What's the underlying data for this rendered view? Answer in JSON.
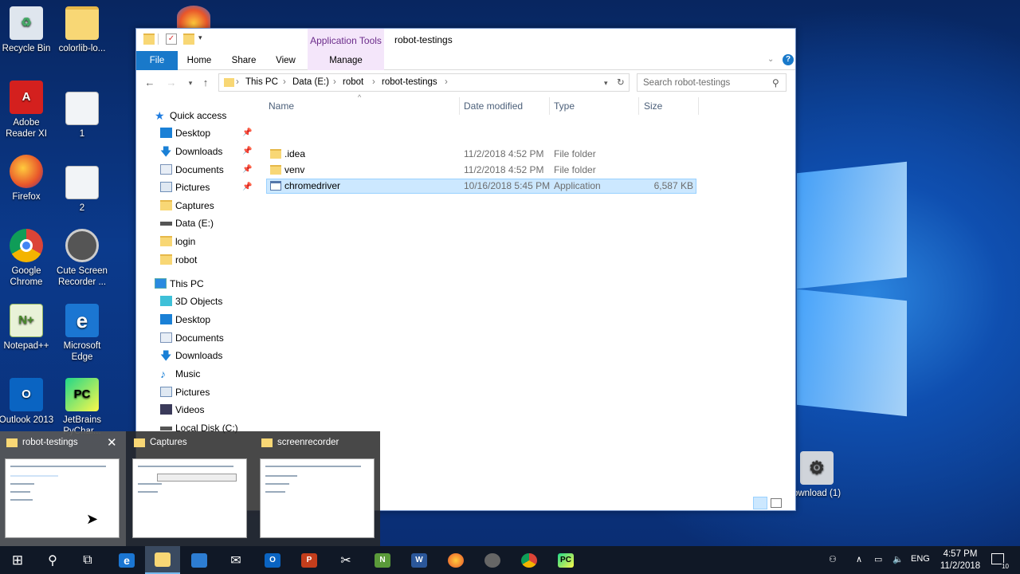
{
  "desktop": {
    "icons": [
      {
        "label": "Recycle Bin",
        "icon": "recycle-bin-icon"
      },
      {
        "label": "colorlib-lo...",
        "icon": "folder-icon"
      },
      {
        "label": "Adobe Reader XI",
        "icon": "adobe-reader-icon"
      },
      {
        "label": "1",
        "icon": "document-thumbnail-icon"
      },
      {
        "label": "Firefox",
        "icon": "firefox-icon"
      },
      {
        "label": "2",
        "icon": "document-thumbnail-icon"
      },
      {
        "label": "Google Chrome",
        "icon": "chrome-icon"
      },
      {
        "label": "Cute Screen Recorder ...",
        "icon": "film-reel-icon"
      },
      {
        "label": "Notepad++",
        "icon": "notepad-plus-icon"
      },
      {
        "label": "Microsoft Edge",
        "icon": "edge-icon"
      },
      {
        "label": "Outlook 2013",
        "icon": "outlook-icon"
      },
      {
        "label": "JetBrains PyChar...",
        "icon": "pycharm-icon"
      },
      {
        "label": "ownload (1)",
        "icon": "gear-setup-icon"
      }
    ]
  },
  "explorer": {
    "title": "robot-testings",
    "context_tab": "Application Tools",
    "tabs": [
      "File",
      "Home",
      "Share",
      "View",
      "Manage"
    ],
    "breadcrumb": [
      "This PC",
      "Data (E:)",
      "robot",
      "robot-testings"
    ],
    "search_placeholder": "Search robot-testings",
    "nav": [
      {
        "label": "Quick access",
        "icon": "star-icon"
      },
      {
        "label": "Desktop",
        "icon": "desktop-icon",
        "pinned": true
      },
      {
        "label": "Downloads",
        "icon": "download-arrow-icon",
        "pinned": true
      },
      {
        "label": "Documents",
        "icon": "documents-icon",
        "pinned": true
      },
      {
        "label": "Pictures",
        "icon": "pictures-icon",
        "pinned": true
      },
      {
        "label": "Captures",
        "icon": "folder-icon"
      },
      {
        "label": "Data (E:)",
        "icon": "drive-icon"
      },
      {
        "label": "login",
        "icon": "folder-icon"
      },
      {
        "label": "robot",
        "icon": "folder-icon"
      },
      {
        "label": "This PC",
        "icon": "computer-icon"
      },
      {
        "label": "3D Objects",
        "icon": "cube-icon"
      },
      {
        "label": "Desktop",
        "icon": "desktop-icon"
      },
      {
        "label": "Documents",
        "icon": "documents-icon"
      },
      {
        "label": "Downloads",
        "icon": "download-arrow-icon"
      },
      {
        "label": "Music",
        "icon": "music-note-icon"
      },
      {
        "label": "Pictures",
        "icon": "pictures-icon"
      },
      {
        "label": "Videos",
        "icon": "video-icon"
      },
      {
        "label": "Local Disk (C:)",
        "icon": "drive-icon"
      }
    ],
    "columns": [
      "Name",
      "Date modified",
      "Type",
      "Size"
    ],
    "files": [
      {
        "name": ".idea",
        "date": "11/2/2018 4:52 PM",
        "type": "File folder",
        "size": "",
        "icon": "folder-icon"
      },
      {
        "name": "venv",
        "date": "11/2/2018 4:52 PM",
        "type": "File folder",
        "size": "",
        "icon": "folder-icon"
      },
      {
        "name": "chromedriver",
        "date": "10/16/2018 5:45 PM",
        "type": "Application",
        "size": "6,587 KB",
        "icon": "application-icon",
        "selected": true
      }
    ]
  },
  "thumbnails": [
    {
      "title": "robot-testings"
    },
    {
      "title": "Captures"
    },
    {
      "title": "screenrecorder"
    }
  ],
  "taskbar": {
    "lang": "ENG",
    "time": "4:57 PM",
    "date": "11/2/2018",
    "notifications": "10"
  },
  "colors": {
    "accent": "#1979ca",
    "selection": "#cce8ff",
    "context_tab": "#f4e6fa",
    "taskbar": "#101826"
  }
}
